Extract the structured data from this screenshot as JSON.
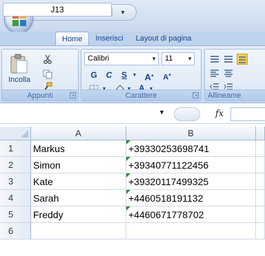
{
  "quick_access": {
    "icons": [
      "save-icon",
      "undo-icon",
      "redo-icon",
      "customize-icon"
    ]
  },
  "tabs": [
    {
      "label": "Home",
      "active": true
    },
    {
      "label": "Inserisci",
      "active": false
    },
    {
      "label": "Layout di pagina",
      "active": false
    }
  ],
  "ribbon": {
    "clipboard": {
      "paste_label": "Incolla",
      "group_label": "Appunti"
    },
    "font": {
      "font_name": "Calibri",
      "font_size": "11",
      "bold": "G",
      "italic": "C",
      "underline": "S",
      "group_label": "Carattere"
    },
    "alignment": {
      "group_label": "Allineame"
    }
  },
  "formula_bar": {
    "name_box": "J13",
    "fx_symbol": "fx",
    "formula": ""
  },
  "columns": [
    "A",
    "B"
  ],
  "rows": [
    {
      "num": "1",
      "a": "Markus",
      "b": "+39330253698741"
    },
    {
      "num": "2",
      "a": "Simon",
      "b": "+39340771122456"
    },
    {
      "num": "3",
      "a": "Kate",
      "b": "+39320117499325"
    },
    {
      "num": "4",
      "a": "Sarah",
      "b": "+4460518191132"
    },
    {
      "num": "5",
      "a": "Freddy",
      "b": "+4460671778702"
    },
    {
      "num": "6",
      "a": "",
      "b": ""
    }
  ],
  "colors": {
    "ribbon_text": "#15428b",
    "error_indicator": "#2e8b2e",
    "header_border": "#9eb6ce"
  }
}
